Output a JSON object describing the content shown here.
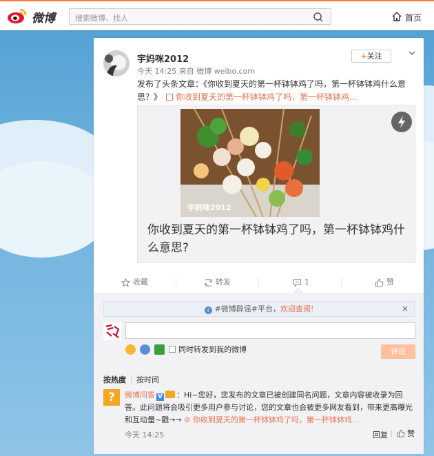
{
  "header": {
    "logo_text": "微博",
    "search_placeholder": "搜索微博、找人",
    "home_label": "首页"
  },
  "post": {
    "author": "宇妈咪2012",
    "meta": "今天 14:25 来自 微博 weibo.com",
    "follow_label": "关注",
    "text_prefix": "发布了头条文章：《你收到夏天的第一杯钵钵鸡了吗，第一杯钵钵鸡什么意思？》",
    "link_text": "你收到夏天的第一杯钵钵鸡了吗，第一杯钵钵鸡...",
    "article": {
      "watermark": "宇妈咪2012",
      "title": "你收到夏天的第一杯钵钵鸡了吗，第一杯钵钵鸡什么意思?"
    }
  },
  "actions": {
    "favorite": "收藏",
    "repost": "转发",
    "comment": "1",
    "like": "赞"
  },
  "comments": {
    "notice_text": "#微博辟谣#平台，",
    "notice_link": "欢迎查阅!",
    "notice_close": "×",
    "repost_label": "同时转发到我的微博",
    "submit_label": "评论",
    "sort_hot": "按热度",
    "sort_time": "按时间",
    "items": [
      {
        "name": "微博问答",
        "body": "：Hi~您好，您发布的文章已被创建同名问题，文章内容被收录为回答。此问题将会吸引更多用户参与讨论，您的文章也会被更多网友看到，带来更高曝光和互动量~戳→→",
        "link": "你收到夏天的第一杯钵钵鸡了吗，第一杯钵钵鸡...",
        "time": "今天 14:25",
        "reply_label": "回复",
        "like_label": "赞"
      }
    ]
  },
  "colors": {
    "accent": "#fa7d3c",
    "link": "#eb7350",
    "background": "#6fb2de"
  }
}
